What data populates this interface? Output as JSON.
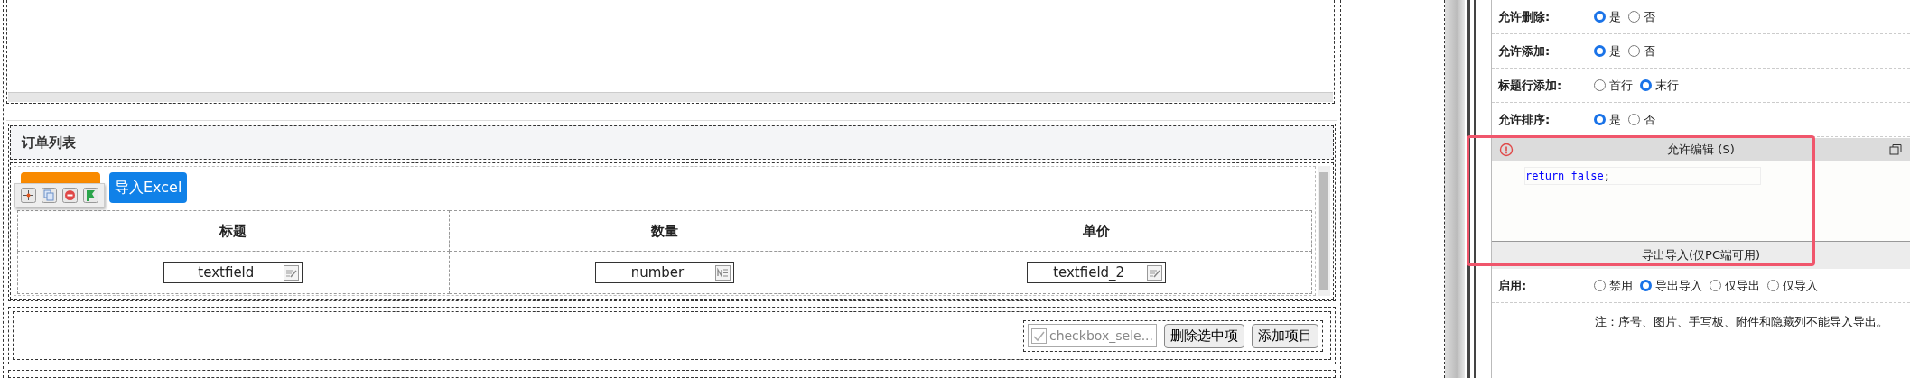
{
  "order_list": {
    "title": "订单列表",
    "toolbar_buttons": [
      {
        "label": "导入Excel",
        "kind": "primary"
      }
    ],
    "table": {
      "columns": [
        "标题",
        "数量",
        "单价"
      ],
      "rows": [
        [
          {
            "value": "textfield",
            "kind": "text"
          },
          {
            "value": "number",
            "kind": "number"
          },
          {
            "value": "textfield_2",
            "kind": "text"
          }
        ]
      ]
    },
    "footer": {
      "checkbox_label": "checkbox_sele...",
      "buttons": [
        "删除选中项",
        "添加项目"
      ]
    }
  },
  "properties": {
    "rows": [
      {
        "label": "允许删除:",
        "options": [
          {
            "label": "是",
            "selected": true
          },
          {
            "label": "否",
            "selected": false
          }
        ]
      },
      {
        "label": "允许添加:",
        "options": [
          {
            "label": "是",
            "selected": true
          },
          {
            "label": "否",
            "selected": false
          }
        ]
      },
      {
        "label": "标题行添加:",
        "options": [
          {
            "label": "首行",
            "selected": false
          },
          {
            "label": "末行",
            "selected": true
          }
        ]
      },
      {
        "label": "允许排序:",
        "options": [
          {
            "label": "是",
            "selected": true
          },
          {
            "label": "否",
            "selected": false
          }
        ]
      }
    ],
    "script_editor": {
      "title": "允许编辑 (S)",
      "code_keyword": "return",
      "code_value": "false",
      "code_end": ";"
    },
    "export_section": {
      "title": "导出导入(仅PC端可用)",
      "rows": [
        {
          "label": "启用:",
          "options": [
            {
              "label": "禁用",
              "selected": false
            },
            {
              "label": "导出导入",
              "selected": true
            },
            {
              "label": "仅导出",
              "selected": false
            },
            {
              "label": "仅导入",
              "selected": false
            }
          ]
        }
      ],
      "note": "注：序号、图片、手写板、附件和隐藏列不能导入导出。"
    }
  }
}
